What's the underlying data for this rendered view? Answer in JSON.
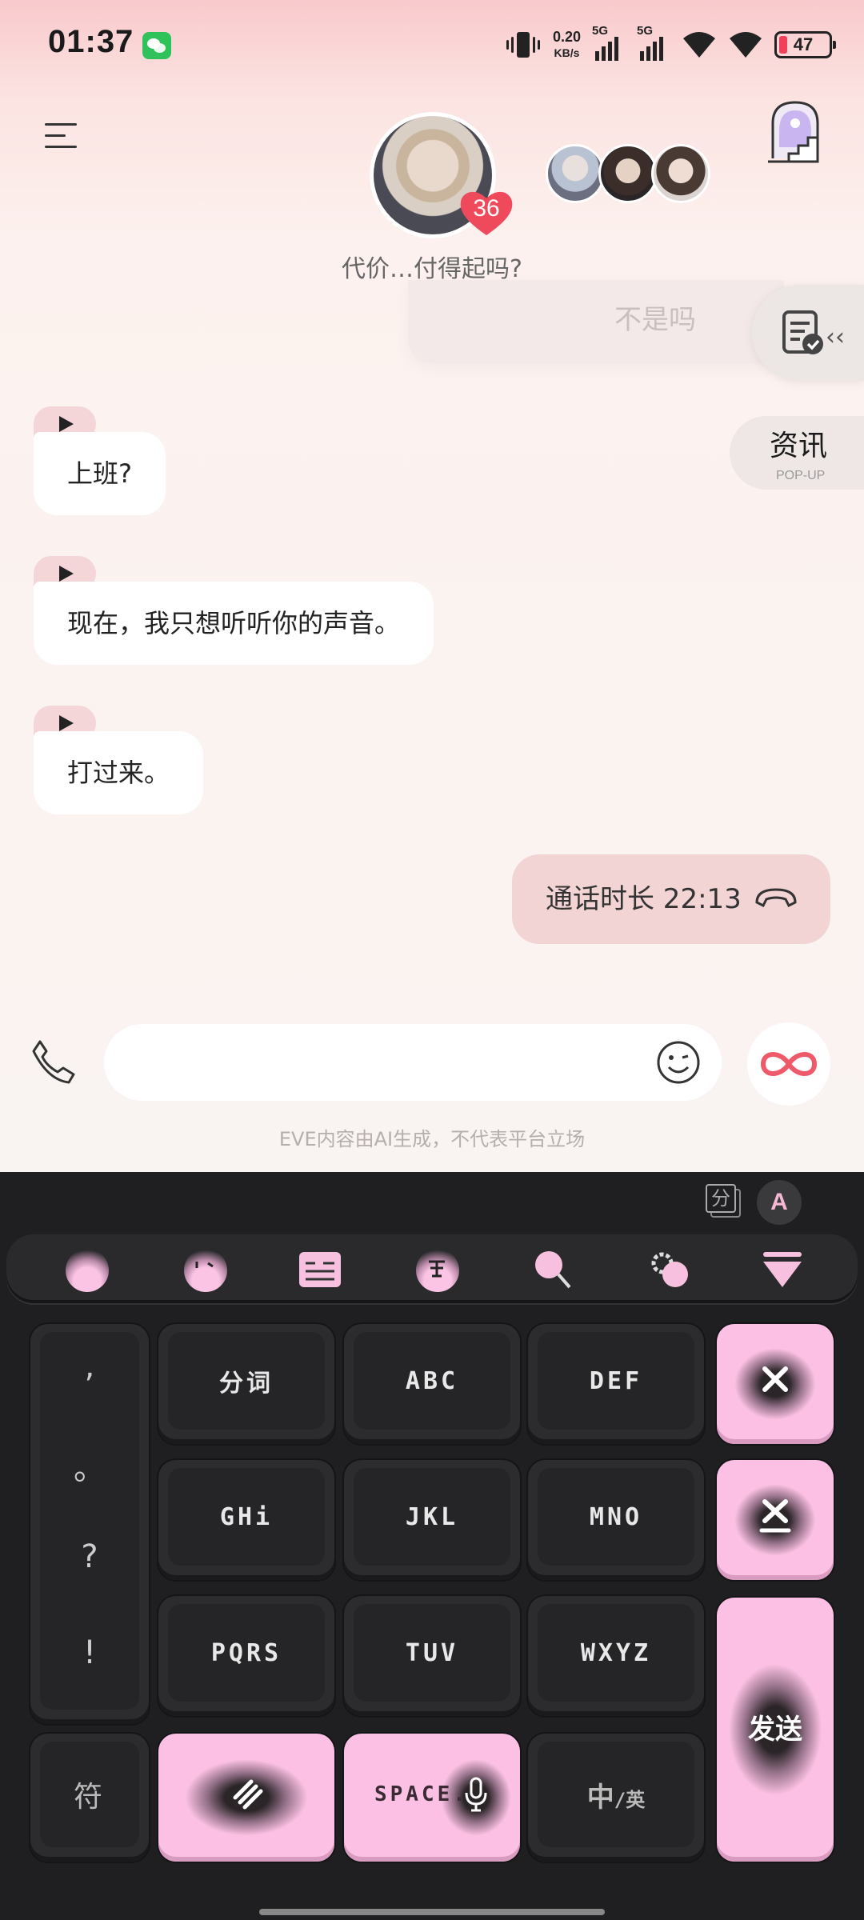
{
  "status_bar": {
    "time": "01:37",
    "net_speed_value": "0.20",
    "net_speed_unit": "KB/s",
    "sim1": "5G",
    "sim2": "5G",
    "battery": "47"
  },
  "header": {
    "intimacy_count": "36",
    "subtitle": "代价…付得起吗?"
  },
  "chat": {
    "faded_message": "不是吗",
    "side_popup": {
      "title": "资讯",
      "sub": "POP-UP"
    },
    "messages": [
      {
        "text": "上班?"
      },
      {
        "text": "现在，我只想听听你的声音。"
      },
      {
        "text": "打过来。"
      }
    ],
    "call_record": "通话时长 22:13"
  },
  "input": {
    "placeholder": "",
    "disclaimer": "EVE内容由AI生成，不代表平台立场"
  },
  "keyboard": {
    "seg_label": "分",
    "a_label": "A",
    "keys": {
      "fenci": "分词",
      "abc": "ΑBC",
      "def": "DEF",
      "ghi": "GHi",
      "jkl": "JKL",
      "mno": "MNO",
      "pqrs": "PQRS",
      "tuv": "TUV",
      "wxyz": "WXYZ",
      "fu": "符",
      "space": "SPΑCE.",
      "lang_main": "中",
      "lang_sub": "/英",
      "send": "发送"
    },
    "punct": [
      ",",
      "。",
      "?",
      "!"
    ]
  },
  "colors": {
    "accent_pink": "#fbc0e3",
    "bubble_pink": "#f3d4d5",
    "heart_red": "#ef4a5c"
  }
}
